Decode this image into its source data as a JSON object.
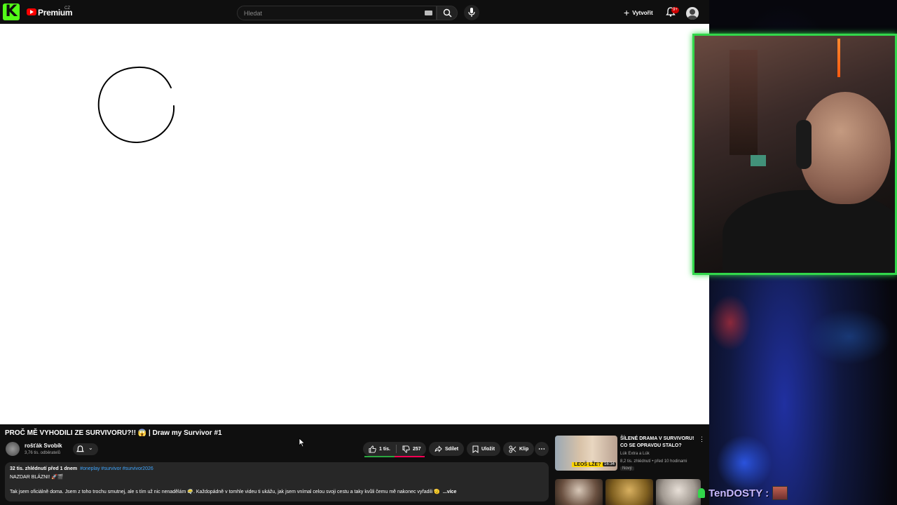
{
  "topbar": {
    "kick_logo": "K",
    "brand": "Premium",
    "region": "CZ",
    "search_placeholder": "Hledat",
    "create_label": "Vytvořit",
    "notification_count": "9+",
    "icons": [
      "kick-logo-icon",
      "youtube-logo-icon",
      "keyboard-icon",
      "search-icon",
      "mic-icon",
      "plus-icon",
      "bell-icon",
      "account-icon"
    ]
  },
  "video": {
    "title": "PROČ MĚ VYHODILI ZE SURVIVORU?!! 😱 | Draw my Survivor #1",
    "channel": "rošťák Svobík",
    "subscribers": "3,76 tis. odběratelů",
    "likes": "1 tis.",
    "dislikes": "257",
    "share_label": "Sdílet",
    "save_label": "Uložit",
    "clip_label": "Klip",
    "more_label": "⋯",
    "like_ratio": 0.5
  },
  "description": {
    "meta": "32 tis. zhlédnutí  před 1 dnem",
    "tags": "#oneplay #survivor #survivor2026",
    "line1": "NAZDAR BLÁZNI! 🚀🎬",
    "line2": "Tak jsem oficiálně doma. Jsem z toho trochu smutnej, ale s tím už nic nenadělám 😶‍🌫️. Každopádně v tomhle videu ti ukážu, jak jsem vnímal celou svoji cestu a taky kvůli čemu mě nakonec vyřadili 🫡",
    "more_label": "...více"
  },
  "recommendation": {
    "title": "ŠÍLENÉ DRAMA V SURVIVORU! CO SE OPRAVDU STALO?",
    "channel": "Lúk Extra a Lúk",
    "views": "8,2 tis. zhlédnutí • před 10 hodinami",
    "badge": "Nový",
    "duration": "16:34",
    "thumb_text": "LEOŠ LŽE?"
  },
  "chat": {
    "username": "TenDOSTY :"
  },
  "colors": {
    "kick_green": "#53fc18",
    "youtube_red": "#ff0000",
    "webcam_border": "#32d74b",
    "link_blue": "#3ea6ff"
  }
}
